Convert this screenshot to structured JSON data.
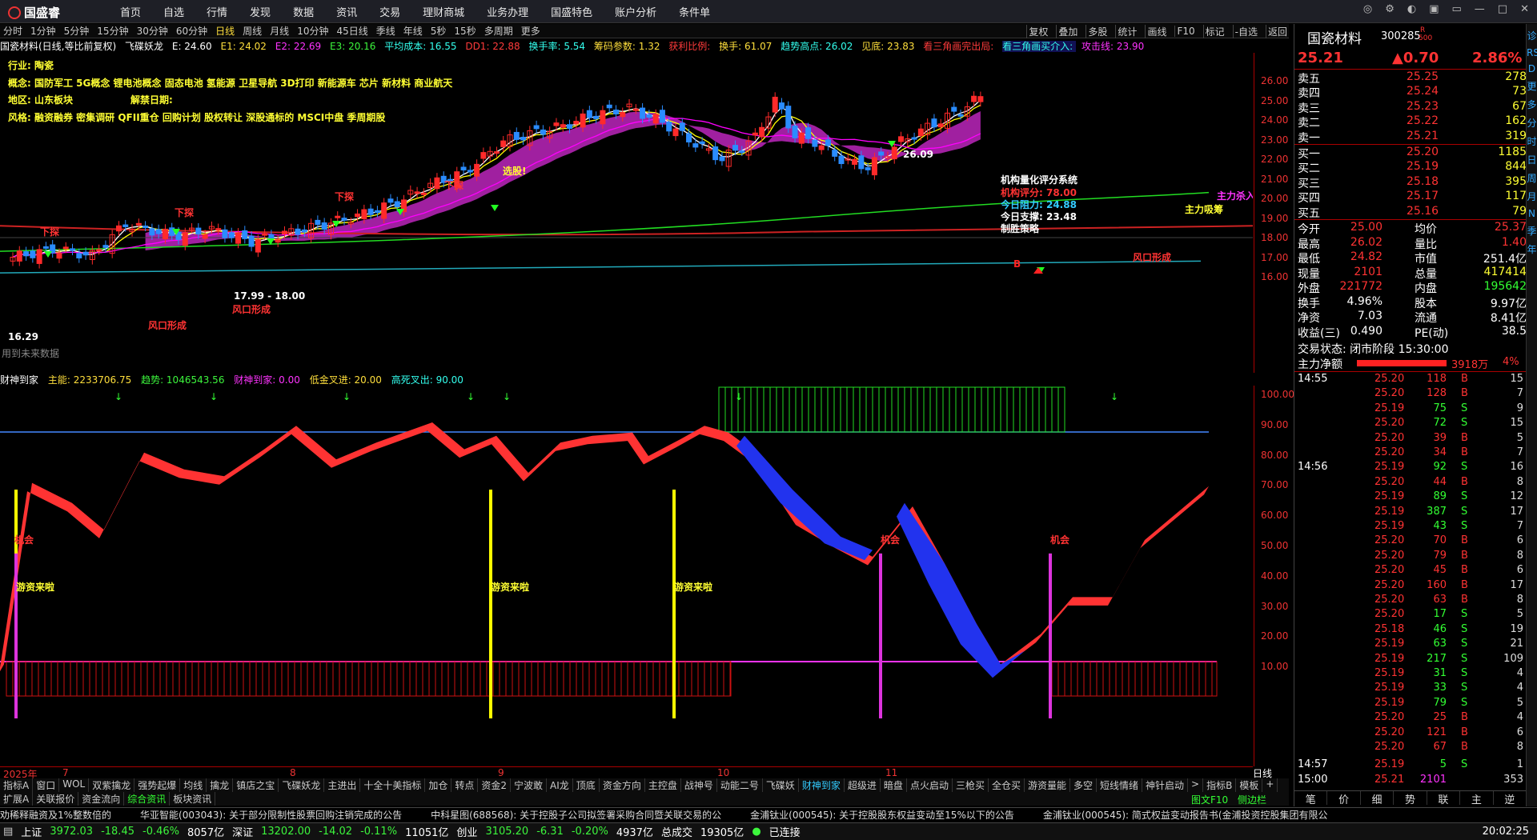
{
  "app": {
    "logo": "国盛睿",
    "menu": [
      "首页",
      "自选",
      "行情",
      "发现",
      "数据",
      "资讯",
      "交易",
      "理财商城",
      "业务办理",
      "国盛特色",
      "账户分析",
      "条件单"
    ]
  },
  "periods": [
    "分时",
    "1分钟",
    "5分钟",
    "15分钟",
    "30分钟",
    "60分钟",
    "日线",
    "周线",
    "月线",
    "10分钟",
    "45日线",
    "季线",
    "年线",
    "5秒",
    "15秒",
    "多周期",
    "更多"
  ],
  "period_selected": "日线",
  "tools": [
    "复权",
    "叠加",
    "多股",
    "统计",
    "画线",
    "F10",
    "标记",
    "-自选",
    "返回"
  ],
  "info": {
    "title": "国瓷材料(日线,等比前复权)",
    "ind": "飞碟妖龙",
    "e": "E: 24.60",
    "e1": "E1: 24.02",
    "e2": "E2: 22.69",
    "e3": "E3: 20.16",
    "avg": "平均成本: 16.55",
    "dd": "DD1: 22.88",
    "hs": "换手率: 5.54",
    "cm": "筹码参数: 1.32",
    "hl": "获利比例: ",
    "hs2": "换手: 61.07",
    "qs": "趋势高点: 26.02",
    "jg": "见底: 23.83",
    "t1": "看三角画完出局: ",
    "t2": "看三角画买介入: ",
    "gj": "攻击线: 23.90"
  },
  "notes": {
    "industry": "行业: 陶瓷",
    "concept": "概念: 国防军工 5G概念 锂电池概念 固态电池 氢能源 卫星导航 3D打印 新能源车 芯片 新材料 商业航天",
    "area": "地区: 山东板块",
    "jiejin": "解禁日期:",
    "style": "风格: 融资融券 密集调研 QFII重仓 回购计划 股权转让 深股通标的 MSCI中盘 季周期股"
  },
  "annotations": {
    "xuangu": "选股!",
    "xiatan1": "下探",
    "xiatan2": "下探",
    "xiatan3": "下探",
    "xiatan4": "下探",
    "fengkou1": "风口形成",
    "fengkou2": "风口形成",
    "fengkou3": "风口形成",
    "range": "17.99 - 18.00",
    "high": "26.09",
    "low": "16.29",
    "zhuli": "主力吸筹",
    "zlsp": "主力杀入",
    "hint": "用到未来数据",
    "jg_title": "机构量化评分系统",
    "jg1": "机构评分: 78.00",
    "jg2": "今日阻力: 24.88",
    "jg3": "今日支撑: 23.48",
    "jg4": "制胜策略"
  },
  "y1": [
    "26.00",
    "25.00",
    "24.00",
    "23.00",
    "22.00",
    "21.00",
    "20.00",
    "19.00",
    "18.00",
    "17.00",
    "16.00"
  ],
  "sub": {
    "name": "财神到家",
    "l1": "主能: 2233706.75",
    "l2": "趋势: 1046543.56",
    "l3": "财神到家: 0.00",
    "l4": "低金叉进: 20.00",
    "l5": "高死叉出: 90.00",
    "jihui1": "机会",
    "jihui2": "机会",
    "jihui3": "机会",
    "youzi1": "游资来啦",
    "youzi2": "游资来啦",
    "youzi3": "游资来啦"
  },
  "y2": [
    "100.00",
    "90.00",
    "80.00",
    "70.00",
    "60.00",
    "50.00",
    "40.00",
    "30.00",
    "20.00",
    "10.00"
  ],
  "xaxis": [
    "2025年",
    "7",
    "8",
    "9",
    "10",
    "11"
  ],
  "tabs1": [
    "指标A",
    "窗口",
    "WOL",
    "双紫擒龙",
    "强势起爆",
    "均线",
    "擒龙",
    "镇店之宝",
    "飞碟妖龙",
    "主进出",
    "十全十美指标",
    "加仓",
    "转点",
    "资金2",
    "宁波敢",
    "AI龙",
    "顶底",
    "资金方向",
    "主控盘",
    "战神号",
    "动能二号",
    "飞碟妖",
    "财神到家",
    "超级进",
    "暗盘",
    "点火启动",
    "三枪买",
    "全仓买",
    "游资量能",
    "多空",
    "短线情绪",
    "神针启动",
    ">",
    "指标B",
    "模板",
    "+"
  ],
  "tabs2": [
    "扩展A",
    "关联报价",
    "资金流向",
    "综合资讯",
    "板块资讯"
  ],
  "tabs_right": [
    "日线",
    "图文F10",
    "侧边栏"
  ],
  "news": [
    "劝稀释融资及1%整数倍的",
    "华亚智能(003043): 关于部分限制性股票回购注销完成的公告",
    "中科星图(688568): 关于控股子公司拟签署采购合同暨关联交易的公",
    "金浦钛业(000545): 关于控股股东权益变动至15%以下的公告",
    "金浦钛业(000545): 简式权益变动报告书(金浦投资控股集团有限公"
  ],
  "status": {
    "sh": "上证",
    "sh_v": "3972.03",
    "sh_c": "-18.45",
    "sh_p": "-0.46%",
    "sh_a": "8057亿",
    "sz": "深证",
    "sz_v": "13202.00",
    "sz_c": "-14.02",
    "sz_p": "-0.11%",
    "sz_a": "11051亿",
    "cy": "创业",
    "cy_v": "3105.20",
    "cy_c": "-6.31",
    "cy_p": "-0.20%",
    "cy_a": "4937亿",
    "total": "总成交",
    "total_v": "19305亿",
    "conn": "已连接",
    "time": "20:02:25"
  },
  "quote": {
    "name": "国瓷材料",
    "code": "300285",
    "r": "R",
    "m": "500",
    "price": "25.21",
    "chg": "▲0.70",
    "pct": "2.86%",
    "asks": [
      [
        "卖五",
        "25.25",
        "278"
      ],
      [
        "卖四",
        "25.24",
        "73"
      ],
      [
        "卖三",
        "25.23",
        "67"
      ],
      [
        "卖二",
        "25.22",
        "162"
      ],
      [
        "卖一",
        "25.21",
        "319"
      ]
    ],
    "bids": [
      [
        "买一",
        "25.20",
        "1185"
      ],
      [
        "买二",
        "25.19",
        "844"
      ],
      [
        "买三",
        "25.18",
        "395"
      ],
      [
        "买四",
        "25.17",
        "117"
      ],
      [
        "买五",
        "25.16",
        "79"
      ]
    ],
    "stats": [
      [
        "今开",
        "25.00",
        "均价",
        "25.37"
      ],
      [
        "最高",
        "26.02",
        "量比",
        "1.40"
      ],
      [
        "最低",
        "24.82",
        "市值",
        "251.4亿"
      ],
      [
        "现量",
        "2101",
        "总量",
        "417414"
      ],
      [
        "外盘",
        "221772",
        "内盘",
        "195642"
      ],
      [
        "换手",
        "4.96%",
        "股本",
        "9.97亿"
      ],
      [
        "净资",
        "7.03",
        "流通",
        "8.41亿"
      ],
      [
        "收益(三)",
        "0.490",
        "PE(动)",
        "38.5"
      ]
    ],
    "state": "交易状态: 闭市阶段 15:30:00",
    "zljl": "主力净额",
    "zljl_v": "3918万",
    "zljl_p": "4%"
  },
  "ticks": [
    [
      "14:55",
      "25.20",
      "118",
      "B",
      "15"
    ],
    [
      "",
      "25.20",
      "128",
      "B",
      "7"
    ],
    [
      "",
      "25.19",
      "75",
      "S",
      "9"
    ],
    [
      "",
      "25.20",
      "72",
      "S",
      "15"
    ],
    [
      "",
      "25.20",
      "39",
      "B",
      "5"
    ],
    [
      "",
      "25.20",
      "34",
      "B",
      "7"
    ],
    [
      "14:56",
      "25.19",
      "92",
      "S",
      "16"
    ],
    [
      "",
      "25.20",
      "44",
      "B",
      "8"
    ],
    [
      "",
      "25.19",
      "89",
      "S",
      "12"
    ],
    [
      "",
      "25.19",
      "387",
      "S",
      "17"
    ],
    [
      "",
      "25.19",
      "43",
      "S",
      "7"
    ],
    [
      "",
      "25.20",
      "70",
      "B",
      "6"
    ],
    [
      "",
      "25.20",
      "79",
      "B",
      "8"
    ],
    [
      "",
      "25.20",
      "45",
      "B",
      "6"
    ],
    [
      "",
      "25.20",
      "160",
      "B",
      "17"
    ],
    [
      "",
      "25.20",
      "63",
      "B",
      "8"
    ],
    [
      "",
      "25.20",
      "17",
      "S",
      "5"
    ],
    [
      "",
      "25.18",
      "46",
      "S",
      "19"
    ],
    [
      "",
      "25.19",
      "63",
      "S",
      "21"
    ],
    [
      "",
      "25.19",
      "217",
      "S",
      "109"
    ],
    [
      "",
      "25.19",
      "31",
      "S",
      "4"
    ],
    [
      "",
      "25.19",
      "33",
      "S",
      "4"
    ],
    [
      "",
      "25.19",
      "79",
      "S",
      "5"
    ],
    [
      "",
      "25.20",
      "25",
      "B",
      "4"
    ],
    [
      "",
      "25.20",
      "121",
      "B",
      "6"
    ],
    [
      "",
      "25.20",
      "67",
      "B",
      "8"
    ],
    [
      "14:57",
      "25.19",
      "5",
      "S",
      "1"
    ],
    [
      "15:00",
      "25.21",
      "2101",
      "",
      "353"
    ]
  ],
  "rtabs": [
    "笔",
    "价",
    "细",
    "势",
    "联",
    "主",
    "逆"
  ],
  "side": [
    "诊",
    "RSI",
    "D",
    "更",
    "多",
    "分",
    "时",
    "日",
    "周",
    "月",
    "N",
    "季",
    "年"
  ]
}
